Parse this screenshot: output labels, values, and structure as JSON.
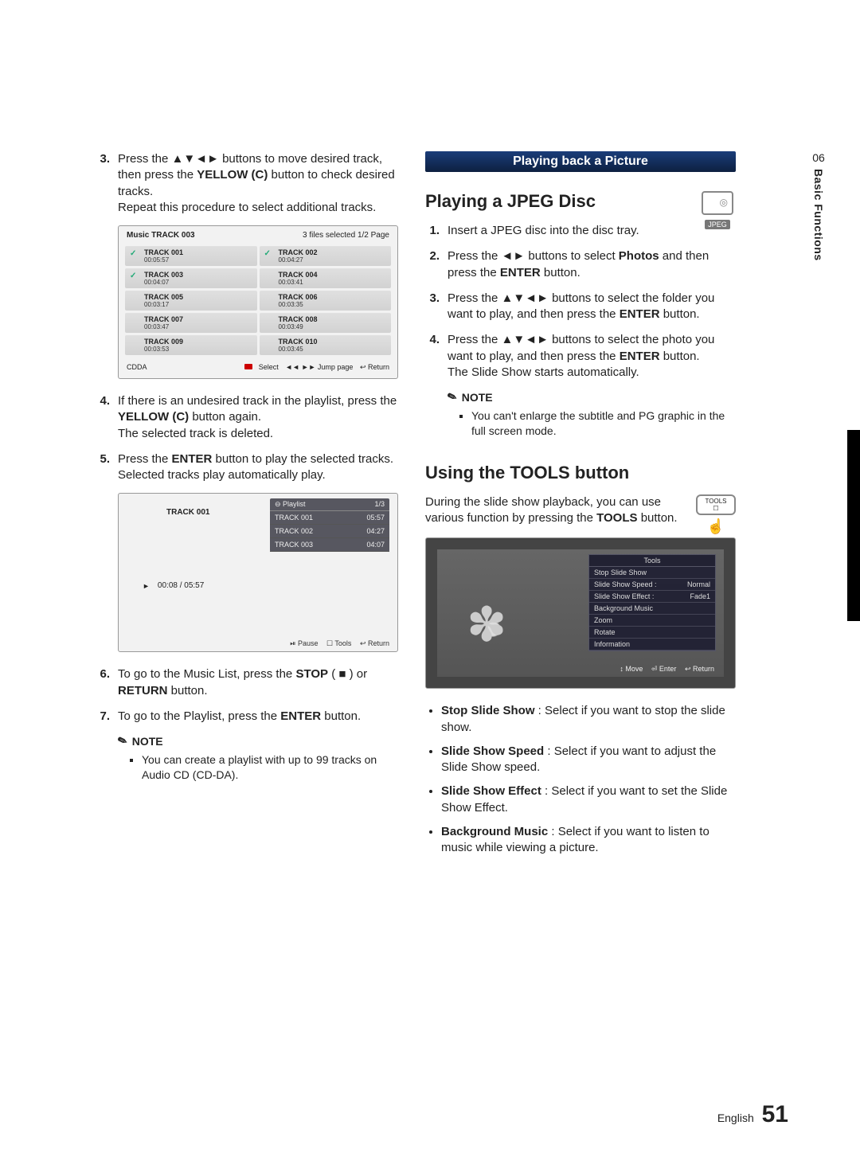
{
  "side": {
    "section_num": "06",
    "section_label": "Basic Functions"
  },
  "footer": {
    "lang": "English",
    "page": "51"
  },
  "left": {
    "step3_a": "Press the ▲▼◄► buttons to move desired track, then press the ",
    "step3_b": "YELLOW (C)",
    "step3_c": " button to check desired tracks.",
    "step3_d": "Repeat this procedure to select additional tracks.",
    "step4_a": "If there is an undesired track in the playlist, press the ",
    "step4_b": "YELLOW (C)",
    "step4_c": " button again.",
    "step4_d": "The selected track is deleted.",
    "step5_a": "Press the ",
    "step5_b": "ENTER",
    "step5_c": " button to play the selected tracks.",
    "step5_d": "Selected tracks play automatically play.",
    "step6_a": "To go to the Music List, press the ",
    "step6_b": "STOP",
    "step6_c": " ( ■ ) or ",
    "step6_d": "RETURN",
    "step6_e": " button.",
    "step7_a": "To go to the Playlist, press the ",
    "step7_b": "ENTER",
    "step7_c": " button.",
    "note_label": "NOTE",
    "note_item": "You can create a playlist with up to 99 tracks on Audio CD (CD-DA).",
    "ss1": {
      "title_left": "Music   TRACK 003",
      "title_right": "3 files selected   1/2 Page",
      "tracks": [
        {
          "name": "TRACK 001",
          "dur": "00:05:57",
          "chk": true
        },
        {
          "name": "TRACK 002",
          "dur": "00:04:27",
          "chk": true
        },
        {
          "name": "TRACK 003",
          "dur": "00:04:07",
          "chk": true
        },
        {
          "name": "TRACK 004",
          "dur": "00:03:41",
          "chk": false
        },
        {
          "name": "TRACK 005",
          "dur": "00:03:17",
          "chk": false
        },
        {
          "name": "TRACK 006",
          "dur": "00:03:35",
          "chk": false
        },
        {
          "name": "TRACK 007",
          "dur": "00:03:47",
          "chk": false
        },
        {
          "name": "TRACK 008",
          "dur": "00:03:49",
          "chk": false
        },
        {
          "name": "TRACK 009",
          "dur": "00:03:53",
          "chk": false
        },
        {
          "name": "TRACK 010",
          "dur": "00:03:45",
          "chk": false
        }
      ],
      "bot_left": "CDDA",
      "bot_sel": "Select",
      "bot_jump": "◄◄ ►► Jump page",
      "bot_ret": "↩ Return"
    },
    "ss2": {
      "now": "TRACK 001",
      "time": "00:08 / 05:57",
      "pl_head": "Playlist",
      "pl_page": "1/3",
      "rows": [
        {
          "n": "TRACK 001",
          "d": "05:57"
        },
        {
          "n": "TRACK 002",
          "d": "04:27"
        },
        {
          "n": "TRACK 003",
          "d": "04:07"
        }
      ],
      "b_pause": "⏯ Pause",
      "b_tools": "☐ Tools",
      "b_return": "↩ Return"
    }
  },
  "right": {
    "bar": "Playing back a Picture",
    "jpeg_label": "JPEG",
    "h1": "Playing a JPEG Disc",
    "s1": "Insert a JPEG disc into the disc tray.",
    "s2_a": "Press the ◄► buttons to select ",
    "s2_b": "Photos",
    "s2_c": " and then press the ",
    "s2_d": "ENTER",
    "s2_e": " button.",
    "s3_a": "Press the ▲▼◄► buttons to select the folder you want to play, and then press the ",
    "s3_b": "ENTER",
    "s3_c": " button.",
    "s4_a": "Press the ▲▼◄► buttons to select the photo you want to play, and then press the ",
    "s4_b": "ENTER",
    "s4_c": " button.",
    "s4_d": "The Slide Show starts automatically.",
    "note_label": "NOTE",
    "note_item": "You can't enlarge the subtitle and PG graphic in the full screen mode.",
    "h2": "Using the TOOLS button",
    "intro_a": "During the slide show playback, you can use various function by pressing the ",
    "intro_b": "TOOLS",
    "intro_c": " button.",
    "tools_badge": "TOOLS",
    "ss": {
      "title": "Tools",
      "rows": [
        {
          "l": "Stop Slide Show",
          "r": ""
        },
        {
          "l": "Slide Show Speed :",
          "r": "Normal"
        },
        {
          "l": "Slide Show Effect :",
          "r": "Fade1"
        },
        {
          "l": "Background Music",
          "r": ""
        },
        {
          "l": "Zoom",
          "r": ""
        },
        {
          "l": "Rotate",
          "r": ""
        },
        {
          "l": "Information",
          "r": ""
        }
      ],
      "b_move": "↕ Move",
      "b_enter": "⏎ Enter",
      "b_return": "↩ Return"
    },
    "bullets": [
      {
        "b": "Stop Slide Show",
        "t": " : Select if you want to stop the slide show."
      },
      {
        "b": "Slide Show Speed",
        "t": " : Select if you want to adjust the Slide Show speed."
      },
      {
        "b": "Slide Show Effect",
        "t": " : Select if you want to set the Slide Show Effect."
      },
      {
        "b": "Background Music",
        "t": " : Select if you want to listen to music while viewing a picture."
      }
    ]
  }
}
